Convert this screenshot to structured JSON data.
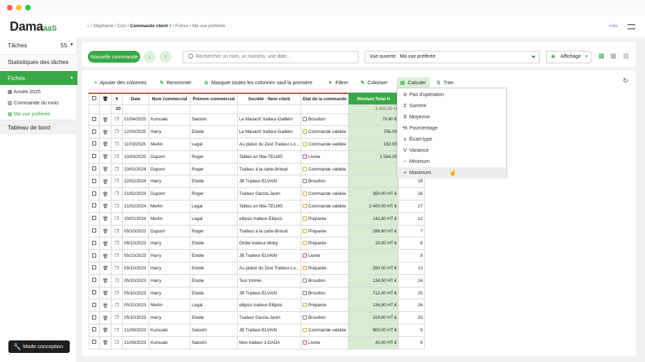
{
  "header": {
    "logo_main": "Dama",
    "logo_suffix": "aaS",
    "breadcrumb": [
      "Stéphanie",
      "Cozi",
      "Commande client",
      "Fiches",
      "Ma vue préférée"
    ],
    "help": "Aide"
  },
  "sidebar": {
    "taches": "Tâches",
    "taches_count": "55",
    "stats": "Statistiques des tâches",
    "fiches": "Fiches",
    "sub": [
      "Année 2025",
      "Commande du mois",
      "Ma vue préférée"
    ],
    "tableau": "Tableau de bord",
    "mode": "Mode conception"
  },
  "toolbar": {
    "new_order": "Nouvelle commande",
    "search_placeholder": "Rechercher un nom, un numéro, une date...",
    "view_label": "Vue ouverte",
    "view_value": "Ma vue préférée",
    "affichage": "Affichage"
  },
  "actions": [
    "Ajouter des colonnes",
    "Renommer",
    "Masquer toutes les colonnes sauf la première",
    "Filtrer",
    "Coloriser",
    "Calculer",
    "Trier"
  ],
  "table": {
    "headers": [
      "Date",
      "Nom commercial",
      "Prénom commercial",
      "Société - Nom client",
      "Etat de la commande",
      "Montant Total H",
      ""
    ],
    "count": "20",
    "sum": "2 400.00 H",
    "rows": [
      [
        "01/04/2025",
        "Kurosaki",
        "Satoshi",
        "Le Manach' traiteur-Galliéni",
        "Brouillon",
        "70.80 €",
        ""
      ],
      [
        "12/03/2025",
        "Harry",
        "Elodie",
        "Le Manach' traiteur-Galliéni",
        "Commande validée",
        "756.00",
        ""
      ],
      [
        "11/03/2025",
        "Merlin",
        "Legal",
        "Au plaisir du Zest Traiteur-Lo...",
        "Commande validée",
        "192.00",
        ""
      ],
      [
        "10/03/2025",
        "Dupont",
        "Roger",
        "Tables en fête-TELMS",
        "Livrée",
        "1 584.00",
        ""
      ],
      [
        "23/02/2024",
        "Dupont",
        "Roger",
        "Traiteur à la carte-Brioud",
        "Commande validée",
        "",
        ""
      ],
      [
        "22/02/2024",
        "Harry",
        "Elodie",
        "JB Traiteur-ELVAIN",
        "Brouillon",
        "",
        "19"
      ],
      [
        "21/02/2024",
        "Dupont",
        "Roger",
        "Traiteur Garcia-Janin",
        "Commande validée",
        "350.00 HT €",
        "16"
      ],
      [
        "21/02/2024",
        "Merlin",
        "Legal",
        "Tables en fête-TELMS",
        "Commande validée",
        "2 400.00 HT €",
        "17"
      ],
      [
        "20/02/2024",
        "Merlin",
        "Legal",
        "ellipsis traiteur-Ellipsis",
        "Préparée",
        "141.60 HT €",
        "12"
      ],
      [
        "05/10/2023",
        "Dupont",
        "Roger",
        "Traiteur à la carte-Brioud",
        "Préparée",
        "286.60 HT €",
        "7"
      ],
      [
        "05/10/2023",
        "Harry",
        "Elodie",
        "Globe traiteur-Moby",
        "Préparée",
        "10.00 HT €",
        "8"
      ],
      [
        "05/10/2023",
        "Harry",
        "Elodie",
        "JB Traiteur-ELVAIN",
        "Livrée",
        "",
        "9"
      ],
      [
        "05/10/2023",
        "Harry",
        "Elodie",
        "Au plaisir du Zest Traiteur-Lo...",
        "Préparée",
        "290.00 HT €",
        "10"
      ],
      [
        "05/10/2023",
        "Harry",
        "Elodie",
        "Test VinHei",
        "Brouillon",
        "134.50 HT €",
        "24"
      ],
      [
        "05/10/2023",
        "Harry",
        "Elodie",
        "JB Traiteur-ELVAIN",
        "Brouillon",
        "712.00 HT €",
        "25"
      ],
      [
        "05/10/2023",
        "Merlin",
        "Legal",
        "ellipsis traiteur-Ellipsis",
        "Préparée",
        "136.80 HT €",
        "26"
      ],
      [
        "05/10/2023",
        "Harry",
        "Elodie",
        "Traiteur Garcia-Janin",
        "Brouillon",
        "319.80 HT €",
        "33"
      ],
      [
        "21/09/2023",
        "Kurosaki",
        "Satoshi",
        "JB Traiteur-ELVAIN",
        "Commande validée",
        "900.00 HT €",
        "5"
      ],
      [
        "21/09/2023",
        "Kurosaki",
        "Satoshi",
        "Mon traiteur 1-DADA",
        "Livrée",
        "40.00 HT €",
        "6"
      ]
    ]
  },
  "calc_menu": [
    {
      "glyph": "⊘",
      "label": "Pas d'opération"
    },
    {
      "glyph": "Σ",
      "label": "Somme"
    },
    {
      "glyph": "X̄",
      "label": "Moyenne"
    },
    {
      "glyph": "%",
      "label": "Pourcentage"
    },
    {
      "glyph": "±",
      "label": "Écart-type"
    },
    {
      "glyph": "V",
      "label": "Variance"
    },
    {
      "glyph": "−",
      "label": "Minimum"
    },
    {
      "glyph": "+",
      "label": "Maximum"
    }
  ],
  "colors": {
    "accent": "#39a845",
    "header_red": "#e04040",
    "highlight": "#d8ecd2"
  }
}
